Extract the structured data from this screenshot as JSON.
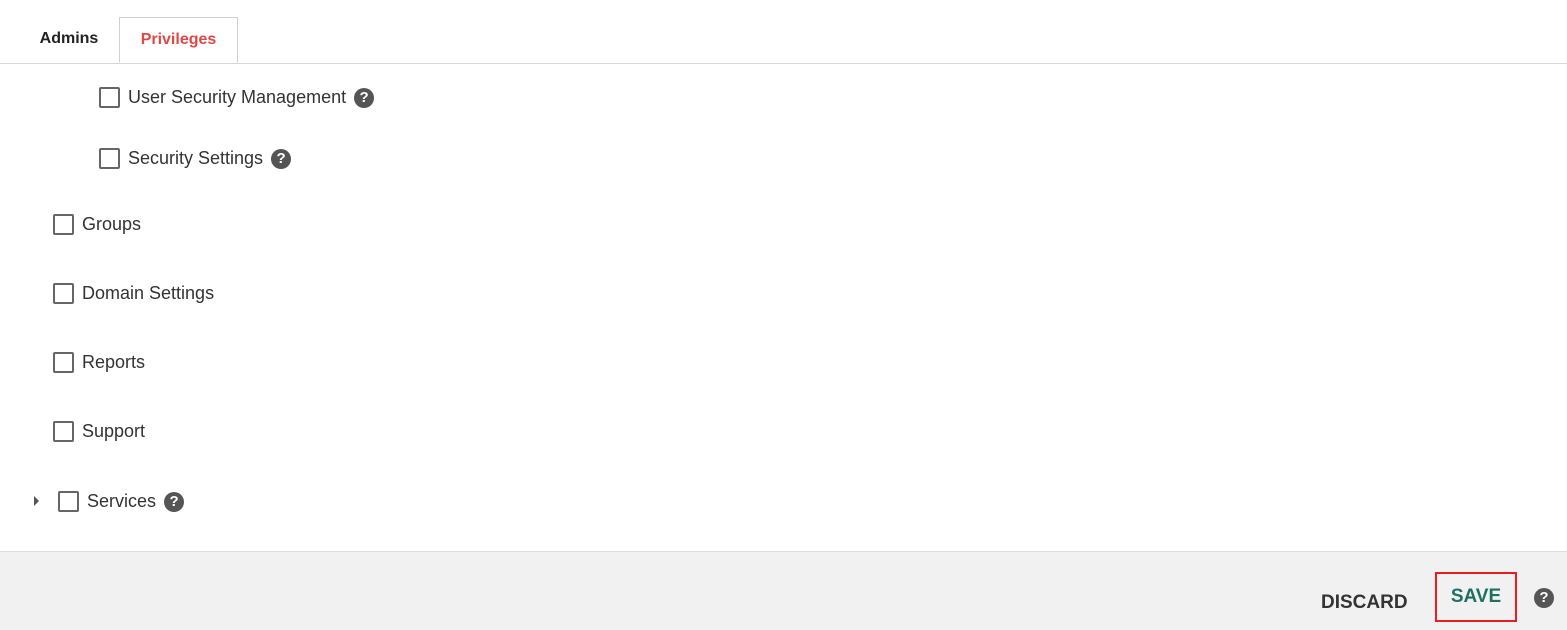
{
  "tabs": [
    {
      "label": "Admins",
      "active": false
    },
    {
      "label": "Privileges",
      "active": true
    }
  ],
  "colors": {
    "active_tab": "#e04848",
    "save": "#1f6f63",
    "highlight_box": "#e81c24",
    "footer_bg": "#f1f1f1"
  },
  "privileges": [
    {
      "label": "User Security Management",
      "checked": false,
      "help": "?"
    },
    {
      "label": "Security Settings",
      "checked": false,
      "help": "?"
    },
    {
      "label": "Groups",
      "checked": false
    },
    {
      "label": "Domain Settings",
      "checked": false
    },
    {
      "label": "Reports",
      "checked": false
    },
    {
      "label": "Support",
      "checked": false
    },
    {
      "label": "Services",
      "checked": false,
      "help": "?",
      "expandable": true,
      "expanded": false
    }
  ],
  "footer": {
    "discard_label": "DISCARD",
    "save_label": "SAVE",
    "help": "?"
  }
}
